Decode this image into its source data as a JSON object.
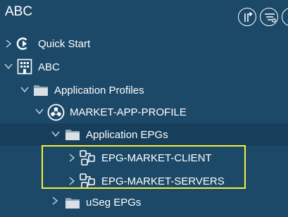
{
  "header": {
    "title": "ABC",
    "buttons": [
      {
        "icon": "tree-collapse-icon"
      },
      {
        "icon": "filter-list-icon"
      },
      {
        "icon": "close-icon"
      }
    ]
  },
  "tree": [
    {
      "label": "Quick Start",
      "icon": "quick-start-icon",
      "expanded": false
    },
    {
      "label": "ABC",
      "icon": "building-icon",
      "expanded": true
    },
    {
      "label": "Application Profiles",
      "icon": "folder-icon",
      "expanded": true
    },
    {
      "label": "MARKET-APP-PROFILE",
      "icon": "app-profile-icon",
      "expanded": true
    },
    {
      "label": "Application EPGs",
      "icon": "folder-icon",
      "expanded": true,
      "selected": true
    },
    {
      "label": "EPG-MARKET-CLIENT",
      "icon": "epg-icon",
      "expanded": false,
      "highlighted": true
    },
    {
      "label": "EPG-MARKET-SERVERS",
      "icon": "epg-icon",
      "expanded": false,
      "highlighted": true
    },
    {
      "label": "uSeg EPGs",
      "icon": "folder-icon",
      "expanded": false
    }
  ],
  "colors": {
    "background": "#1c4968",
    "selected_row": "#173f5b",
    "highlight": "#f4ee3b",
    "text": "#ffffff"
  }
}
